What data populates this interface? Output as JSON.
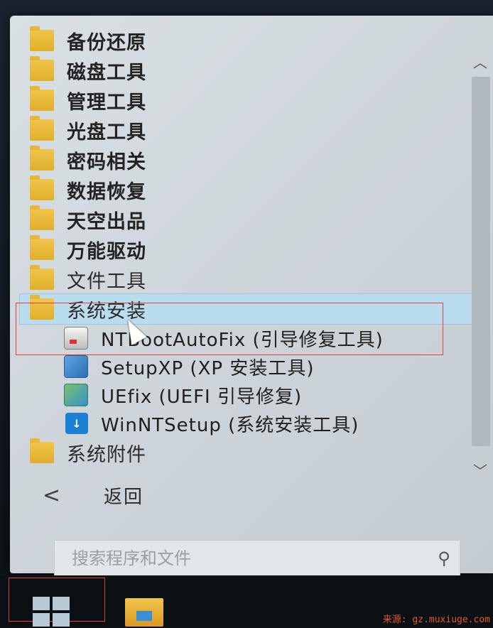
{
  "program_list": {
    "folders_top": [
      {
        "label": "备份还原"
      },
      {
        "label": "磁盘工具"
      },
      {
        "label": "管理工具"
      },
      {
        "label": "光盘工具"
      },
      {
        "label": "密码相关"
      },
      {
        "label": "数据恢复"
      },
      {
        "label": "天空出品"
      },
      {
        "label": "万能驱动"
      },
      {
        "label": "文件工具"
      }
    ],
    "expanded_folder": {
      "label": "系统安装"
    },
    "subitems": [
      {
        "label": "NTBootAutoFix (引导修复工具)",
        "icon": "boot-fix-icon"
      },
      {
        "label": "SetupXP (XP 安装工具)",
        "icon": "setup-xp-icon"
      },
      {
        "label": "UEfix (UEFI 引导修复)",
        "icon": "uefix-icon"
      },
      {
        "label": "WinNTSetup (系统安装工具)",
        "icon": "winntsetup-icon"
      }
    ],
    "folder_bottom": {
      "label": "系统附件"
    }
  },
  "back": {
    "label": "返回",
    "arrow": "<"
  },
  "search": {
    "placeholder": "搜索程序和文件",
    "icon": "⚲"
  },
  "watermark": "来源: gz.muxiuge.com",
  "colors": {
    "folder": "#e6b73a",
    "selection": "#b9dcee",
    "annotation": "#e1403a"
  }
}
